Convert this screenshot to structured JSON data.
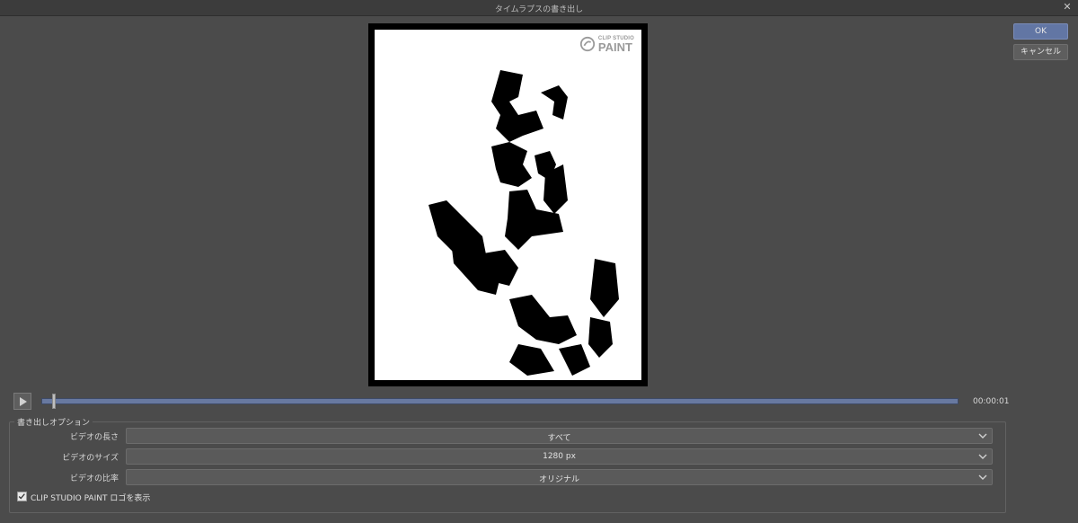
{
  "window": {
    "title": "タイムラプスの書き出し"
  },
  "preview": {
    "logo_line1": "CLIP STUDIO",
    "logo_line2": "PAINT"
  },
  "buttons": {
    "ok": "OK",
    "cancel": "キャンセル"
  },
  "player": {
    "timecode": "00:00:01",
    "progress": 0.01
  },
  "options": {
    "group_title": "書き出しオプション",
    "rows": [
      {
        "label": "ビデオの長さ",
        "value": "すべて"
      },
      {
        "label": "ビデオのサイズ",
        "value": "1280 px"
      },
      {
        "label": "ビデオの比率",
        "value": "オリジナル"
      }
    ],
    "logo_checkbox": {
      "label": "CLIP STUDIO PAINT ロゴを表示",
      "checked": true
    }
  },
  "icons": [
    "close-icon",
    "clip-studio-logo-icon",
    "play-icon",
    "chevron-down-icon",
    "checkmark-icon"
  ]
}
